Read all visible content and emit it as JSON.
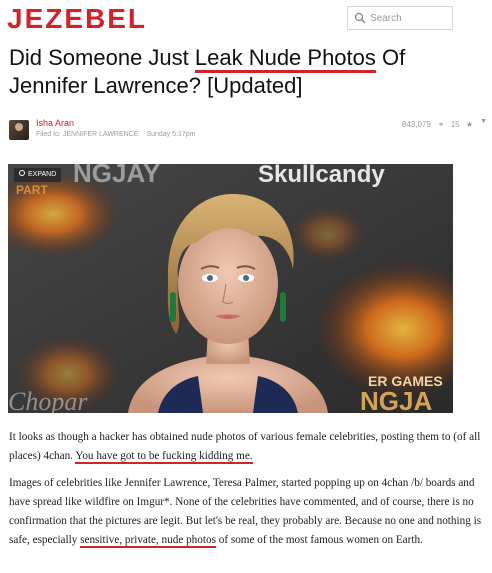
{
  "header": {
    "logo": "JEZEBEL",
    "search_placeholder": "Search"
  },
  "article": {
    "title_part1": "Did Someone Just ",
    "title_highlight": "Leak Nude Photos",
    "title_part2": " Of Jennifer Lawrence? [Updated]",
    "author": "Isha Aran",
    "filed_to": "Filed to: JENNIFER LAWRENCE",
    "date": "Sunday 5:17pm",
    "views": "843,079",
    "comments": "15",
    "expand_label": "EXPAND",
    "para1_text": "It looks as though a hacker has obtained nude photos of various female celebrities, posting them to (of all places) 4chan. ",
    "para1_highlight": "You have got to be fucking kidding me.",
    "para2_text1": "Images of celebrities like Jennifer Lawrence, Teresa Palmer, started popping up on 4chan /b/ boards and have spread like wildfire on Imgur*. None of the celebrities have commented, and of course, there is no confirmation that the pictures are legit. But let's be real, they probably are. Because no one and nothing is safe, especially ",
    "para2_highlight": "sensitive, private, nude photos",
    "para2_text2": " of some of the most famous women on Earth."
  },
  "image": {
    "backdrop_text_top": "Skullcandy",
    "backdrop_text_left_top": "NGJAY",
    "backdrop_text_left": "PART",
    "backdrop_text_right1": "ER GAMES",
    "backdrop_text_right2": "NGJA",
    "backdrop_text_bottom_left": "Chopar"
  },
  "colors": {
    "brand": "#d2232a"
  }
}
